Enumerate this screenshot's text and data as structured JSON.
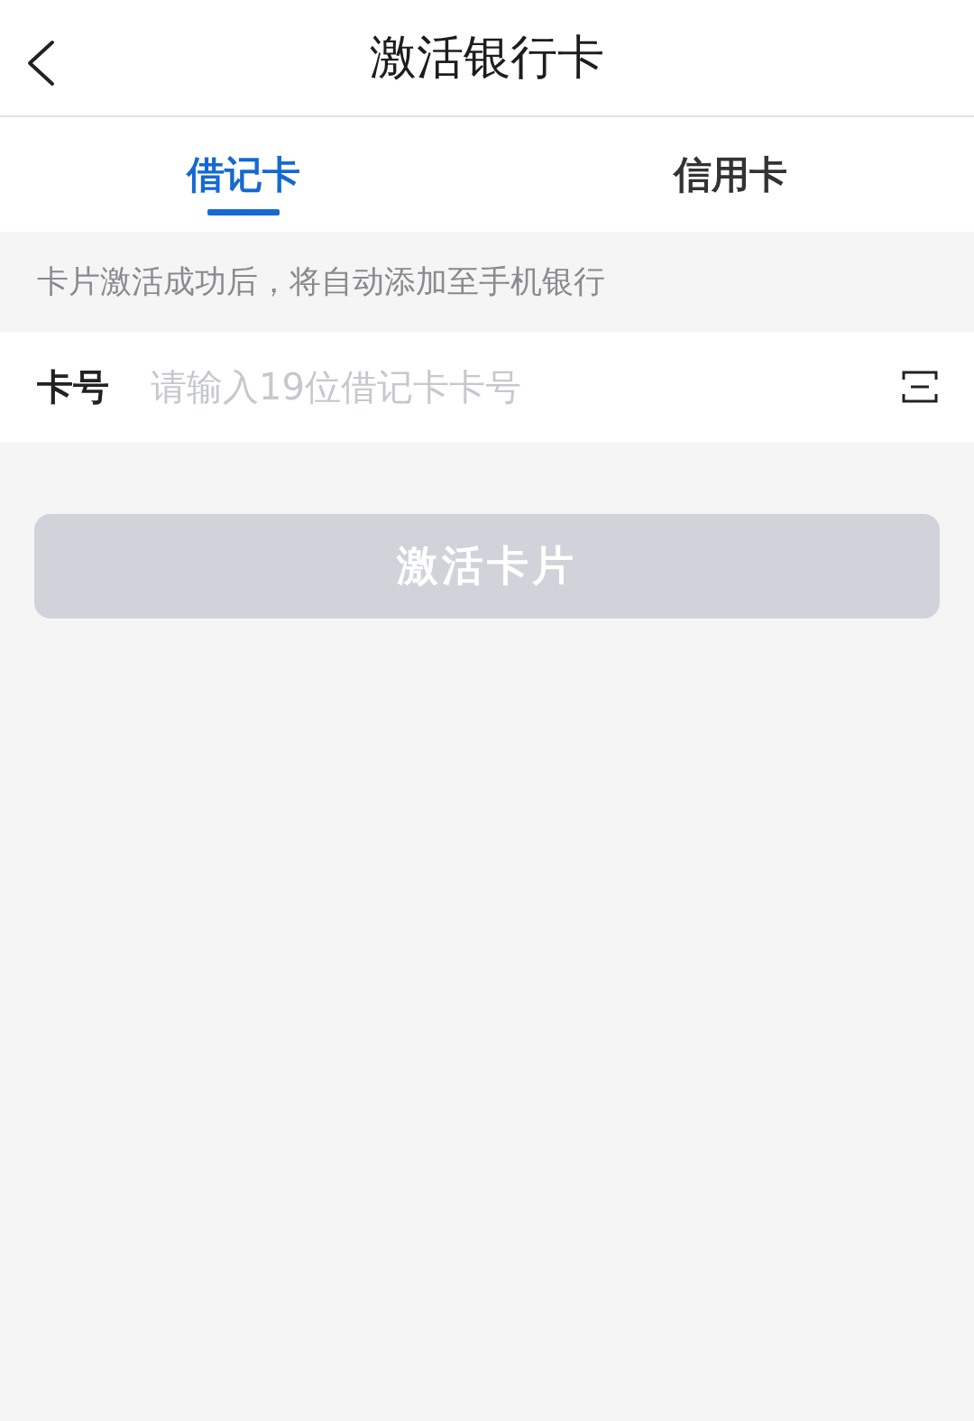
{
  "header": {
    "title": "激活银行卡"
  },
  "tabs": [
    {
      "label": "借记卡",
      "selected": true
    },
    {
      "label": "信用卡",
      "selected": false
    }
  ],
  "notice": "卡片激活成功后，将自动添加至手机银行",
  "card_field": {
    "label": "卡号",
    "placeholder": "请输入19位借记卡卡号"
  },
  "submit": {
    "label": "激活卡片",
    "disabled": true
  }
}
